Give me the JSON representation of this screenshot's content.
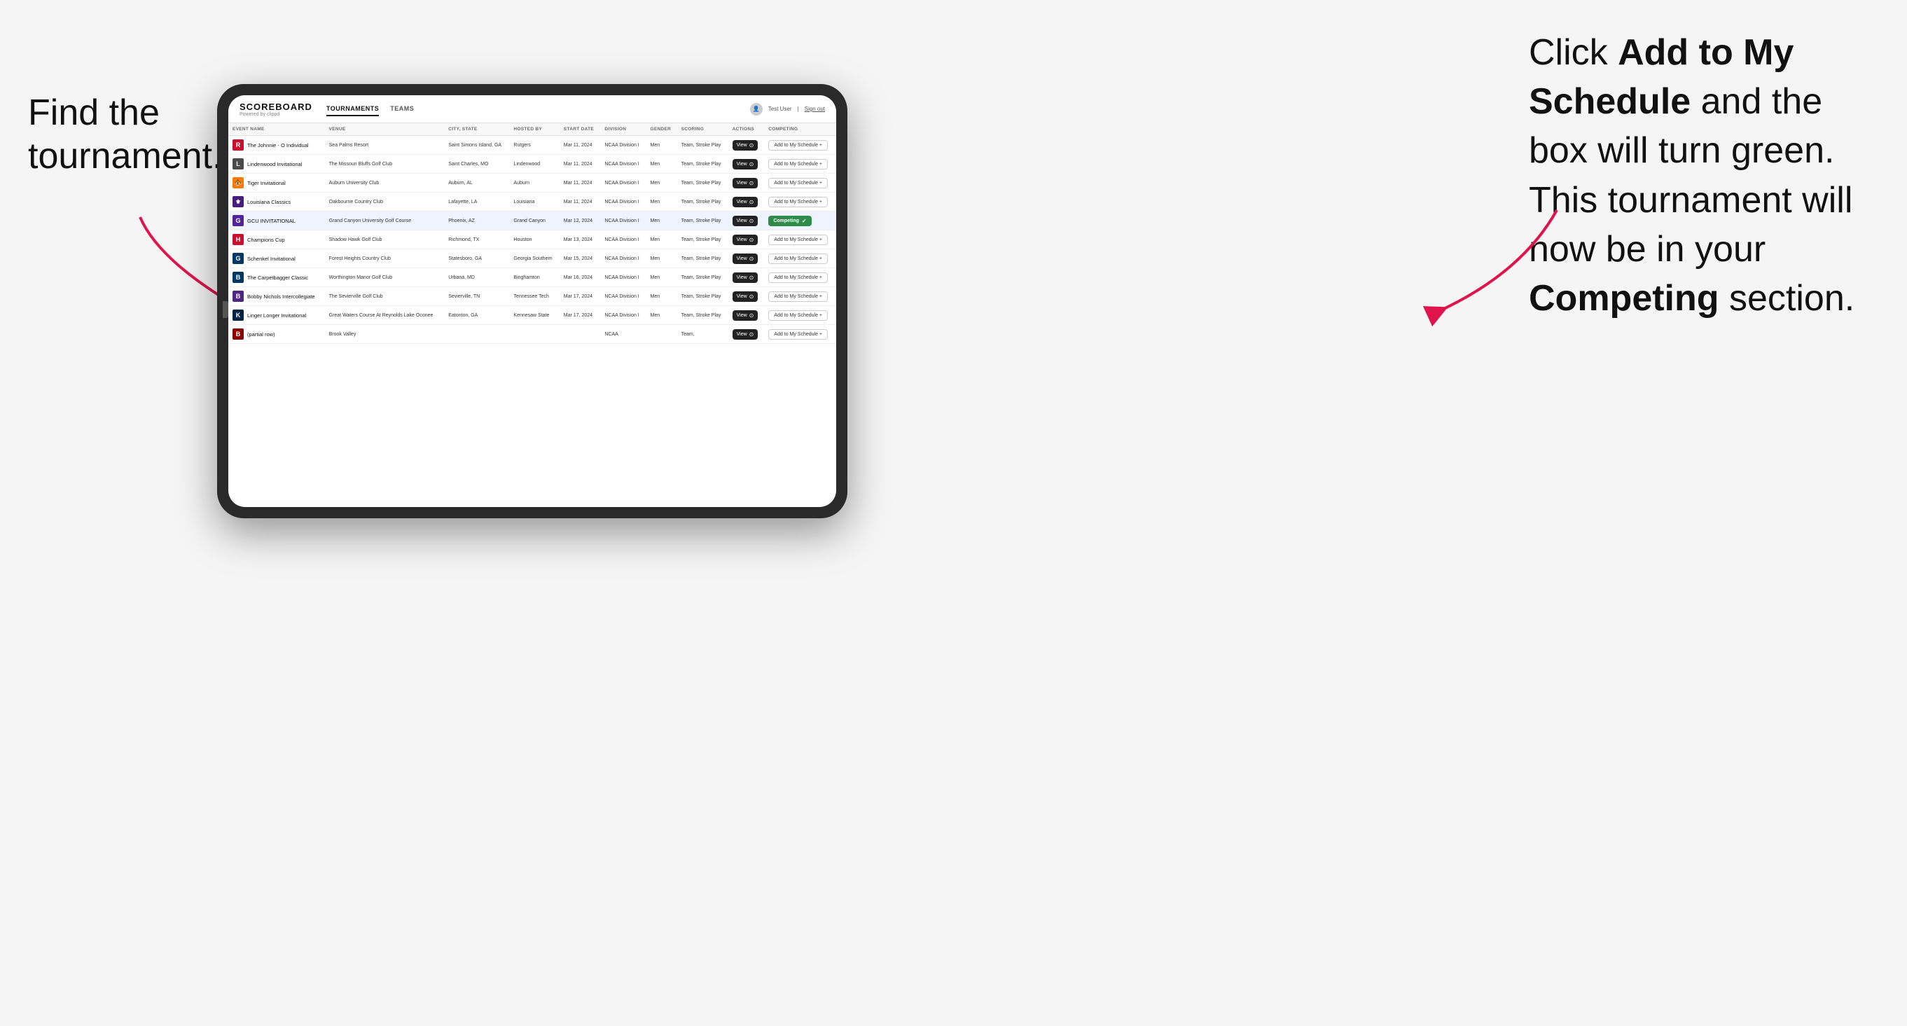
{
  "annotations": {
    "left": "Find the\ntournament.",
    "right_line1": "Click ",
    "right_bold1": "Add to My\nSchedule",
    "right_line2": " and the\nbox will turn green.\nThis tournament\nwill now be in\nyour ",
    "right_bold2": "Competing",
    "right_line3": "\nsection."
  },
  "app": {
    "logo": "SCOREBOARD",
    "logo_sub": "Powered by clippd",
    "nav_tabs": [
      "TOURNAMENTS",
      "TEAMS"
    ],
    "active_tab": "TOURNAMENTS",
    "user_label": "Test User",
    "signout_label": "Sign out"
  },
  "table": {
    "columns": [
      "EVENT NAME",
      "VENUE",
      "CITY, STATE",
      "HOSTED BY",
      "START DATE",
      "DIVISION",
      "GENDER",
      "SCORING",
      "ACTIONS",
      "COMPETING"
    ],
    "rows": [
      {
        "logo_text": "R",
        "logo_color": "#c8102e",
        "name": "The Johnnie - O Individual",
        "venue": "Sea Palms Resort",
        "city_state": "Saint Simons Island, GA",
        "hosted_by": "Rutgers",
        "start_date": "Mar 11, 2024",
        "division": "NCAA Division I",
        "gender": "Men",
        "scoring": "Team, Stroke Play",
        "status": "add",
        "highlighted": false
      },
      {
        "logo_text": "L",
        "logo_color": "#4a4a4a",
        "name": "Lindenwood Invitational",
        "venue": "The Missouri Bluffs Golf Club",
        "city_state": "Saint Charles, MO",
        "hosted_by": "Lindenwood",
        "start_date": "Mar 11, 2024",
        "division": "NCAA Division I",
        "gender": "Men",
        "scoring": "Team, Stroke Play",
        "status": "add",
        "highlighted": false
      },
      {
        "logo_text": "🐯",
        "logo_color": "#ff7900",
        "name": "Tiger Invitational",
        "venue": "Auburn University Club",
        "city_state": "Auburn, AL",
        "hosted_by": "Auburn",
        "start_date": "Mar 11, 2024",
        "division": "NCAA Division I",
        "gender": "Men",
        "scoring": "Team, Stroke Play",
        "status": "add",
        "highlighted": false
      },
      {
        "logo_text": "⚜",
        "logo_color": "#461d7c",
        "name": "Louisiana Classics",
        "venue": "Oakbourne Country Club",
        "city_state": "Lafayette, LA",
        "hosted_by": "Louisiana",
        "start_date": "Mar 11, 2024",
        "division": "NCAA Division I",
        "gender": "Men",
        "scoring": "Team, Stroke Play",
        "status": "add",
        "highlighted": false
      },
      {
        "logo_text": "G",
        "logo_color": "#522398",
        "name": "GCU INVITATIONAL",
        "venue": "Grand Canyon University Golf Course",
        "city_state": "Phoenix, AZ",
        "hosted_by": "Grand Canyon",
        "start_date": "Mar 12, 2024",
        "division": "NCAA Division I",
        "gender": "Men",
        "scoring": "Team, Stroke Play",
        "status": "competing",
        "highlighted": true
      },
      {
        "logo_text": "H",
        "logo_color": "#c8102e",
        "name": "Champions Cup",
        "venue": "Shadow Hawk Golf Club",
        "city_state": "Richmond, TX",
        "hosted_by": "Houston",
        "start_date": "Mar 13, 2024",
        "division": "NCAA Division I",
        "gender": "Men",
        "scoring": "Team, Stroke Play",
        "status": "add",
        "highlighted": false
      },
      {
        "logo_text": "G",
        "logo_color": "#003865",
        "name": "Schenkel Invitational",
        "venue": "Forest Heights Country Club",
        "city_state": "Statesboro, GA",
        "hosted_by": "Georgia Southern",
        "start_date": "Mar 15, 2024",
        "division": "NCAA Division I",
        "gender": "Men",
        "scoring": "Team, Stroke Play",
        "status": "add",
        "highlighted": false
      },
      {
        "logo_text": "B",
        "logo_color": "#003865",
        "name": "The Carpetbagger Classic",
        "venue": "Worthington Manor Golf Club",
        "city_state": "Urbana, MD",
        "hosted_by": "Binghamton",
        "start_date": "Mar 16, 2024",
        "division": "NCAA Division I",
        "gender": "Men",
        "scoring": "Team, Stroke Play",
        "status": "add",
        "highlighted": false
      },
      {
        "logo_text": "B",
        "logo_color": "#4e2683",
        "name": "Bobby Nichols Intercollegiate",
        "venue": "The Sevierville Golf Club",
        "city_state": "Sevierville, TN",
        "hosted_by": "Tennessee Tech",
        "start_date": "Mar 17, 2024",
        "division": "NCAA Division I",
        "gender": "Men",
        "scoring": "Team, Stroke Play",
        "status": "add",
        "highlighted": false
      },
      {
        "logo_text": "K",
        "logo_color": "#002244",
        "name": "Linger Longer Invitational",
        "venue": "Great Waters Course At Reynolds Lake Oconee",
        "city_state": "Eatonton, GA",
        "hosted_by": "Kennesaw State",
        "start_date": "Mar 17, 2024",
        "division": "NCAA Division I",
        "gender": "Men",
        "scoring": "Team, Stroke Play",
        "status": "add",
        "highlighted": false
      },
      {
        "logo_text": "B",
        "logo_color": "#8B0000",
        "name": "(partial row)",
        "venue": "Brook Valley",
        "city_state": "",
        "hosted_by": "",
        "start_date": "",
        "division": "NCAA",
        "gender": "",
        "scoring": "Team,",
        "status": "add",
        "highlighted": false
      }
    ],
    "view_btn_label": "View",
    "add_btn_label": "Add to My Schedule +",
    "competing_btn_label": "Competing ✓"
  }
}
